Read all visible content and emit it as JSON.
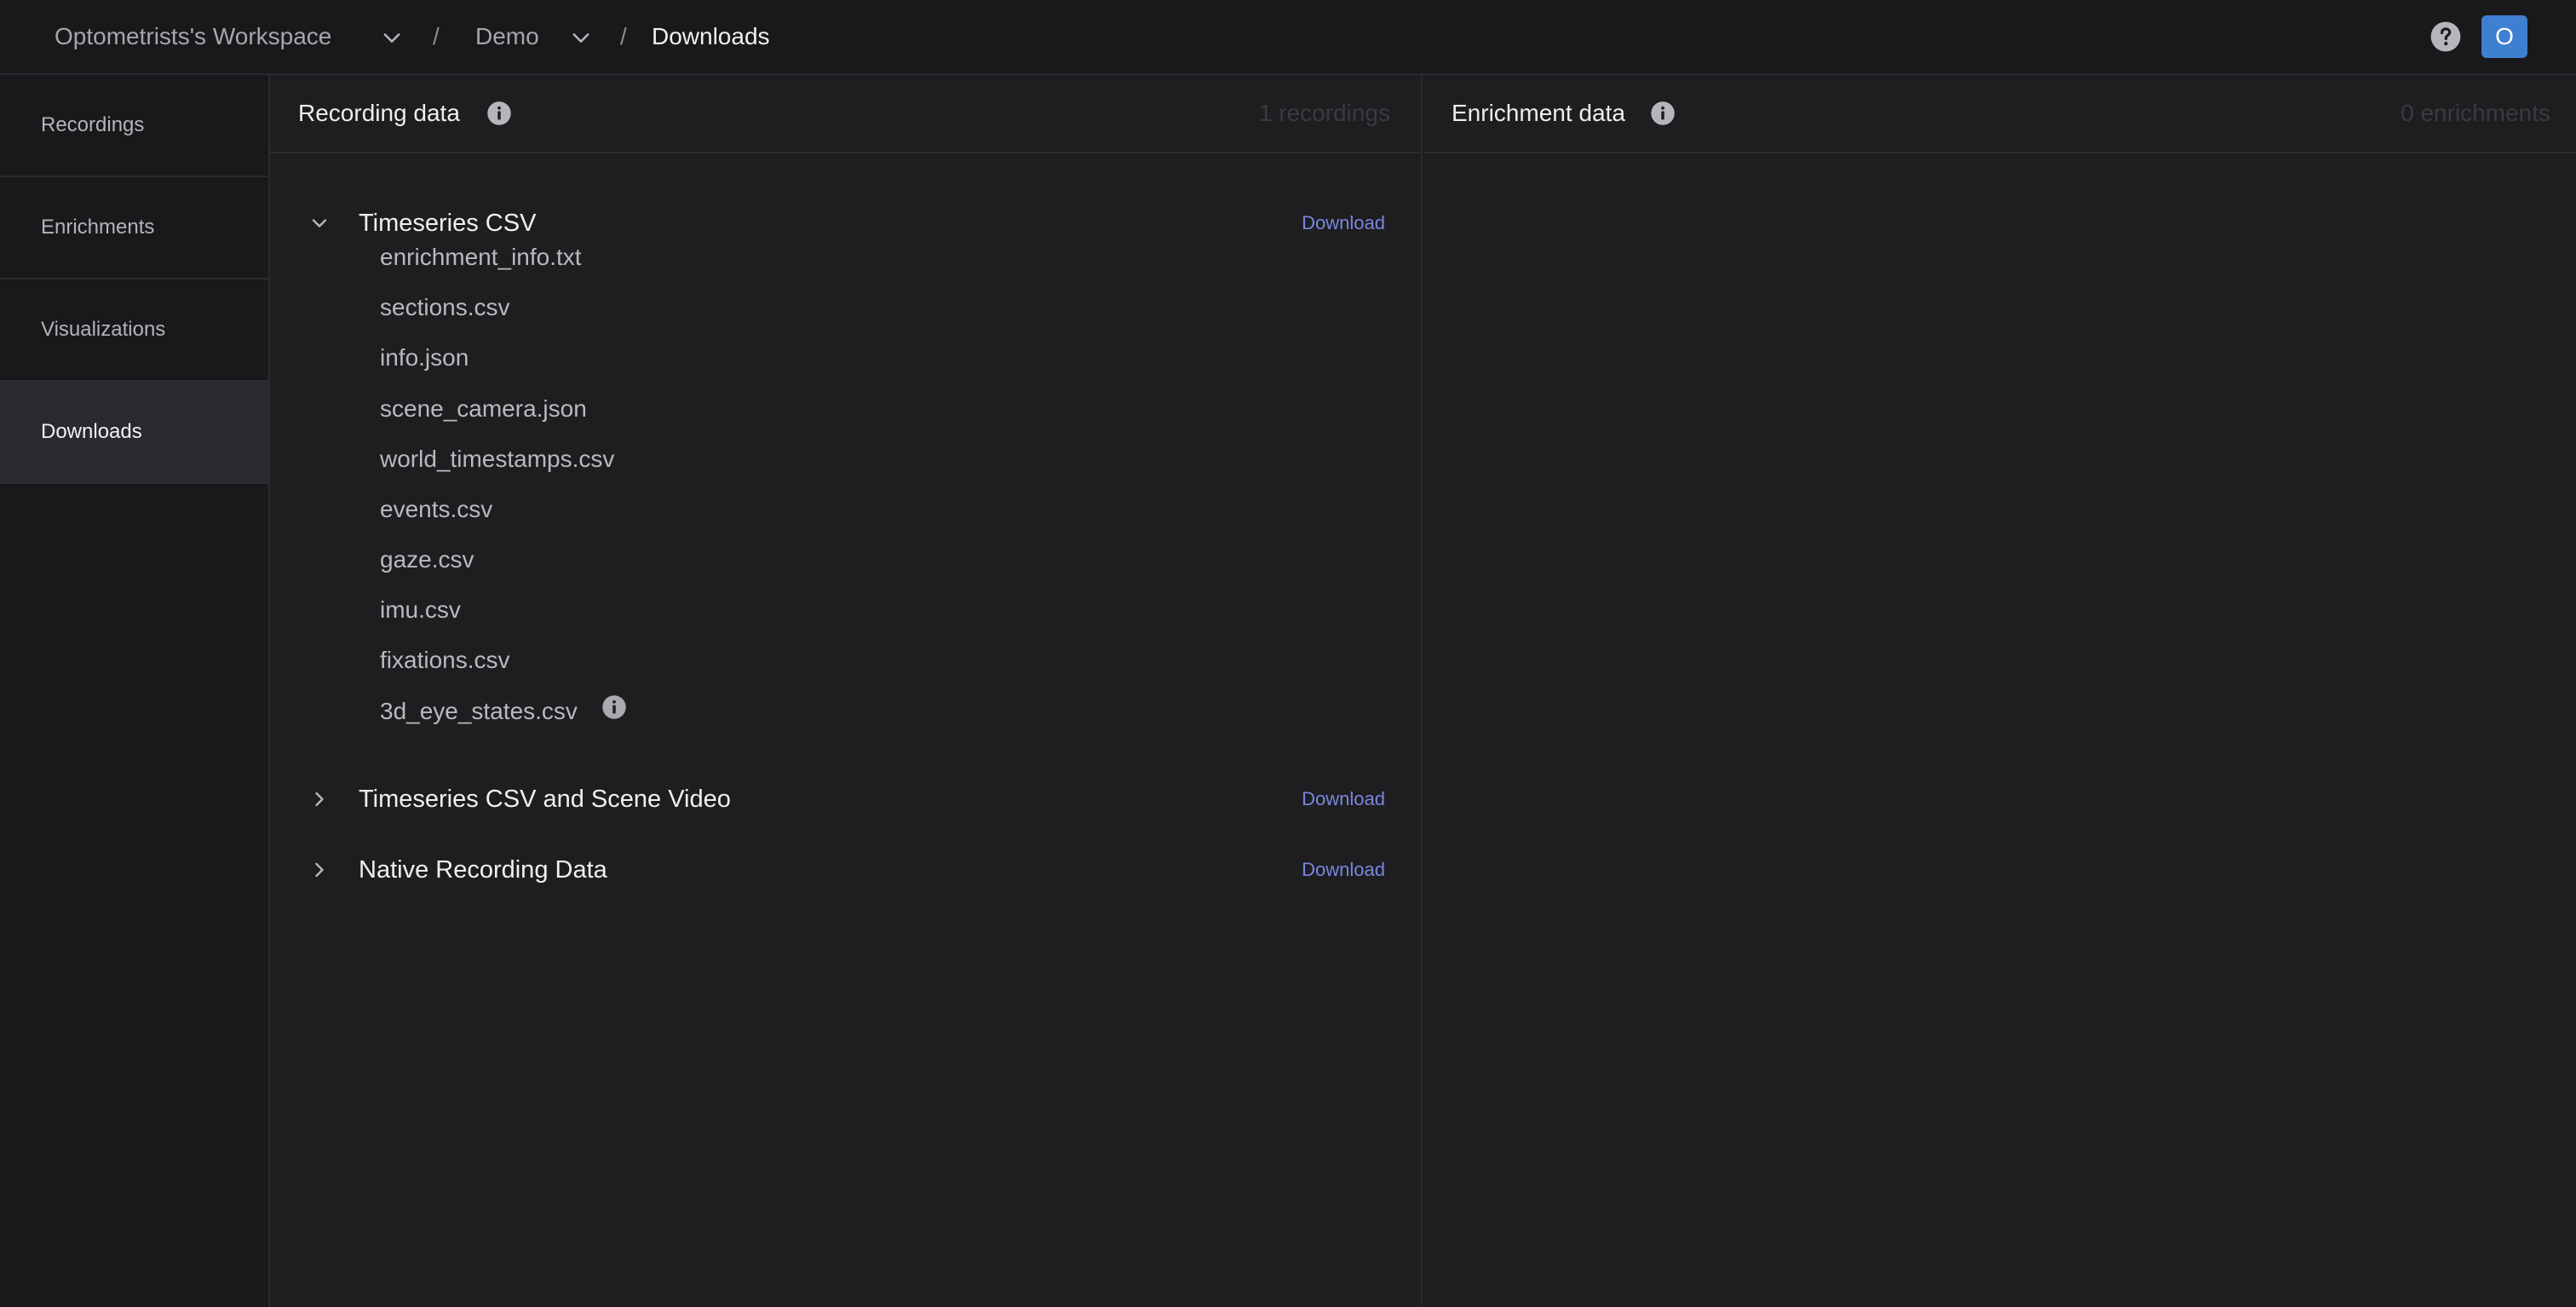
{
  "breadcrumb": {
    "workspace": "Optometrists's Workspace",
    "project": "Demo",
    "page": "Downloads",
    "separator": "/"
  },
  "header": {
    "avatar_initial": "O",
    "avatar_color": "#3f7fd0"
  },
  "sidebar": {
    "items": [
      {
        "label": "Recordings",
        "active": false
      },
      {
        "label": "Enrichments",
        "active": false
      },
      {
        "label": "Visualizations",
        "active": false
      },
      {
        "label": "Downloads",
        "active": true
      }
    ]
  },
  "recording_panel": {
    "title": "Recording data",
    "count": "1 recordings",
    "sections": [
      {
        "title": "Timeseries CSV",
        "expanded": true,
        "download_label": "Download",
        "files": [
          "enrichment_info.txt",
          "sections.csv",
          "info.json",
          "scene_camera.json",
          "world_timestamps.csv",
          "events.csv",
          "gaze.csv",
          "imu.csv",
          "fixations.csv",
          "3d_eye_states.csv"
        ]
      },
      {
        "title": "Timeseries CSV and Scene Video",
        "expanded": false,
        "download_label": "Download"
      },
      {
        "title": "Native Recording Data",
        "expanded": false,
        "download_label": "Download"
      }
    ]
  },
  "enrichment_panel": {
    "title": "Enrichment data",
    "count": "0 enrichments"
  },
  "colors": {
    "background": "#1c1c1f",
    "link": "#7b86dc",
    "active_nav": "#2a2a2e"
  }
}
